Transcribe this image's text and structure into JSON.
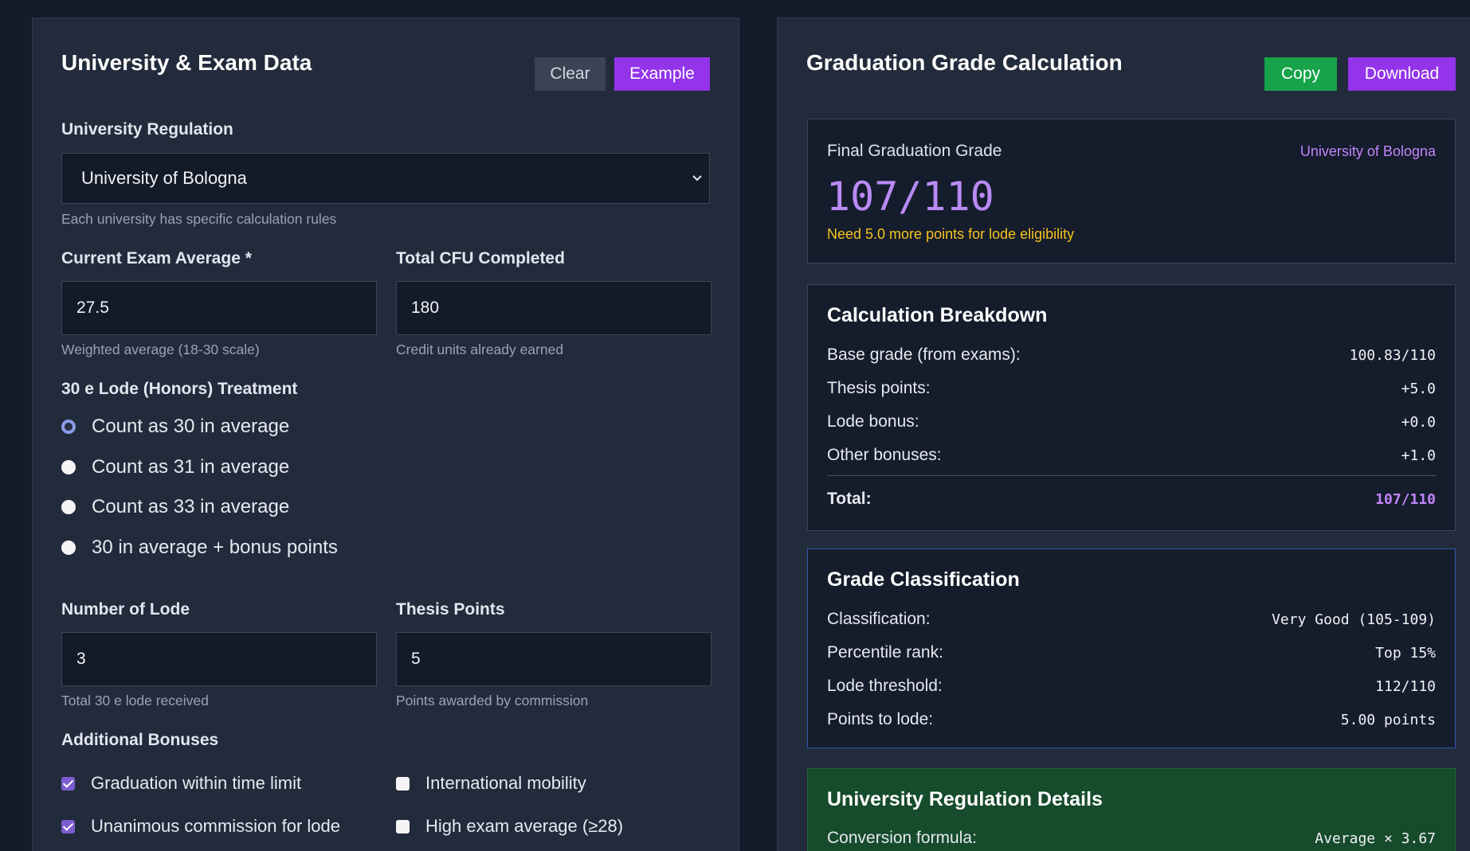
{
  "left": {
    "title": "University & Exam Data",
    "clear_label": "Clear",
    "example_label": "Example",
    "regulation": {
      "label": "University Regulation",
      "value": "University of Bologna",
      "hint": "Each university has specific calculation rules"
    },
    "exam_average": {
      "label": "Current Exam Average *",
      "value": "27.5",
      "hint": "Weighted average (18-30 scale)"
    },
    "cfu": {
      "label": "Total CFU Completed",
      "value": "180",
      "hint": "Credit units already earned"
    },
    "lode_treatment": {
      "label": "30 e Lode (Honors) Treatment",
      "options": [
        {
          "label": "Count as 30 in average",
          "checked": true
        },
        {
          "label": "Count as 31 in average",
          "checked": false
        },
        {
          "label": "Count as 33 in average",
          "checked": false
        },
        {
          "label": "30 in average + bonus points",
          "checked": false
        }
      ]
    },
    "lode_count": {
      "label": "Number of Lode",
      "value": "3",
      "hint": "Total 30 e lode received"
    },
    "thesis": {
      "label": "Thesis Points",
      "value": "5",
      "hint": "Points awarded by commission"
    },
    "bonuses": {
      "label": "Additional Bonuses",
      "items": [
        {
          "label": "Graduation within time limit",
          "checked": true
        },
        {
          "label": "International mobility",
          "checked": false
        },
        {
          "label": "Unanimous commission for lode",
          "checked": true
        },
        {
          "label": "High exam average (≥28)",
          "checked": false
        }
      ]
    }
  },
  "right": {
    "title": "Graduation Grade Calculation",
    "copy_label": "Copy",
    "download_label": "Download",
    "final": {
      "label": "Final Graduation Grade",
      "university": "University of Bologna",
      "grade": "107/110",
      "note": "Need 5.0 more points for lode eligibility"
    },
    "breakdown": {
      "title": "Calculation Breakdown",
      "rows": [
        {
          "k": "Base grade (from exams):",
          "v": "100.83/110"
        },
        {
          "k": "Thesis points:",
          "v": "+5.0"
        },
        {
          "k": "Lode bonus:",
          "v": "+0.0"
        },
        {
          "k": "Other bonuses:",
          "v": "+1.0"
        }
      ],
      "total": {
        "k": "Total:",
        "v": "107/110"
      }
    },
    "classification": {
      "title": "Grade Classification",
      "rows": [
        {
          "k": "Classification:",
          "v": "Very Good (105-109)"
        },
        {
          "k": "Percentile rank:",
          "v": "Top 15%"
        },
        {
          "k": "Lode threshold:",
          "v": "112/110"
        },
        {
          "k": "Points to lode:",
          "v": "5.00 points"
        }
      ]
    },
    "regulation_details": {
      "title": "University Regulation Details",
      "rows": [
        {
          "k": "Conversion formula:",
          "v": "Average × 3.67"
        }
      ]
    }
  },
  "colors": {
    "background": "#141b2b",
    "panel": "#222b3b",
    "accent_purple": "#9333ea",
    "accent_green": "#16a34a",
    "grade_purple": "#b98af5",
    "warning_yellow": "#f4c41f"
  }
}
